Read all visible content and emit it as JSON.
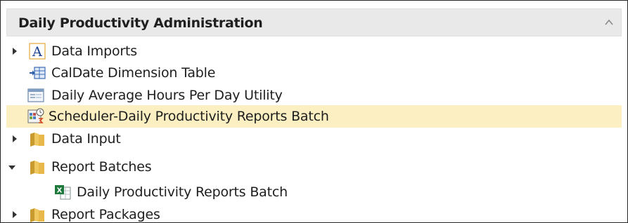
{
  "panel": {
    "title": "Daily Productivity Administration",
    "collapse_icon": "chevron-up-icon"
  },
  "tree": {
    "items": [
      {
        "label": "Data Imports",
        "icon": "text-a-icon",
        "expander": "collapsed"
      },
      {
        "label": "CalDate Dimension Table",
        "icon": "import-table-icon",
        "expander": "none"
      },
      {
        "label": "Daily Average Hours Per Day Utility",
        "icon": "form-window-icon",
        "expander": "none"
      },
      {
        "label": "Scheduler-Daily Productivity Reports Batch",
        "icon": "scheduler-icon",
        "expander": "none",
        "selected": true
      },
      {
        "label": "Data Input",
        "icon": "folder-icon",
        "expander": "collapsed"
      },
      {
        "label": "Report Batches",
        "icon": "folder-icon",
        "expander": "expanded"
      },
      {
        "label": "Daily Productivity Reports Batch",
        "icon": "excel-batch-icon",
        "expander": "none"
      },
      {
        "label": "Report Packages",
        "icon": "folder-icon",
        "expander": "collapsed"
      }
    ]
  },
  "colors": {
    "selection": "#fcf0c3",
    "header_bg": "#e9e9e9",
    "folder": "#e8b84a",
    "excel_green": "#1e7a3c"
  }
}
